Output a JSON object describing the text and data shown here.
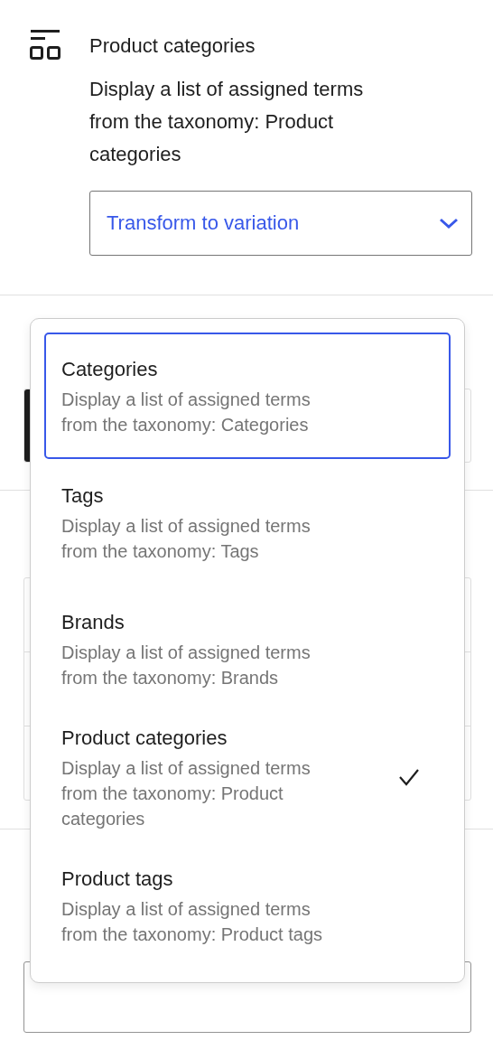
{
  "block_card": {
    "title": "Product categories",
    "description": "Display a list of assigned terms from the taxonomy: Product categories",
    "variation_select": {
      "value": "Transform to variation"
    }
  },
  "variations_menu": {
    "items": [
      {
        "title": "Categories",
        "description": "Display a list of assigned terms from the taxonomy: Categories",
        "focused": true,
        "selected": false
      },
      {
        "title": "Tags",
        "description": "Display a list of assigned terms from the taxonomy: Tags",
        "focused": false,
        "selected": false
      },
      {
        "title": "Brands",
        "description": "Display a list of assigned terms from the taxonomy: Brands",
        "focused": false,
        "selected": false
      },
      {
        "title": "Product categories",
        "description": "Display a list of assigned terms from the taxonomy: Product categories",
        "focused": false,
        "selected": true
      },
      {
        "title": "Product tags",
        "description": "Display a list of assigned terms from the taxonomy: Product tags",
        "focused": false,
        "selected": false
      }
    ]
  }
}
